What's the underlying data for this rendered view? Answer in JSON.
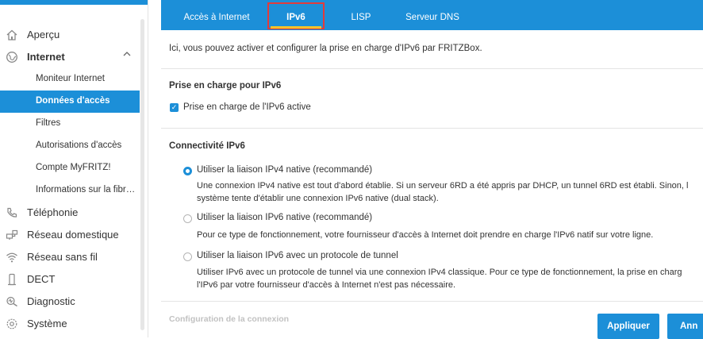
{
  "sidebar": {
    "items": [
      {
        "label": "Aperçu",
        "icon": "home-icon"
      },
      {
        "label": "Internet",
        "icon": "globe-icon",
        "expanded": true
      },
      {
        "label": "Téléphonie",
        "icon": "phone-icon"
      },
      {
        "label": "Réseau domestique",
        "icon": "network-icon"
      },
      {
        "label": "Réseau sans fil",
        "icon": "wifi-icon"
      },
      {
        "label": "DECT",
        "icon": "dect-icon"
      },
      {
        "label": "Diagnostic",
        "icon": "diagnostic-icon"
      },
      {
        "label": "Système",
        "icon": "system-icon"
      }
    ],
    "internet_sub": [
      {
        "label": "Moniteur Internet"
      },
      {
        "label": "Données d'accès",
        "active": true
      },
      {
        "label": "Filtres"
      },
      {
        "label": "Autorisations d'accès"
      },
      {
        "label": "Compte MyFRITZ!"
      },
      {
        "label": "Informations sur la fibr…"
      }
    ]
  },
  "tabs": [
    {
      "label": "Accès à Internet"
    },
    {
      "label": "IPv6",
      "active": true
    },
    {
      "label": "LISP"
    },
    {
      "label": "Serveur DNS"
    }
  ],
  "main": {
    "intro": "Ici, vous pouvez activer et configurer la prise en charge d'IPv6 par FRITZBox.",
    "support_title": "Prise en charge pour IPv6",
    "support_checkbox_label": "Prise en charge de l'IPv6 active",
    "support_checked": true,
    "connectivity_title": "Connectivité IPv6",
    "options": [
      {
        "label": "Utiliser la liaison IPv4 native (recommandé)",
        "selected": true,
        "desc_line1": "Une connexion IPv4 native est tout d'abord établie. Si un serveur 6RD a été appris par DHCP, un tunnel 6RD est établi. Sinon, l",
        "desc_line2": "système tente d'établir une connexion IPv6 native (dual stack)."
      },
      {
        "label": "Utiliser la liaison IPv6 native (recommandé)",
        "selected": false,
        "desc_line1": "Pour ce type de fonctionnement, votre fournisseur d'accès à Internet doit prendre en charge l'IPv6 natif sur votre ligne.",
        "desc_line2": ""
      },
      {
        "label": "Utiliser la liaison IPv6 avec un protocole de tunnel",
        "selected": false,
        "desc_line1": "Utiliser IPv6 avec un protocole de tunnel via une connexion IPv4 classique. Pour ce type de fonctionnement, la prise en charg",
        "desc_line2": "l'IPv6 par votre fournisseur d'accès à Internet n'est pas nécessaire."
      }
    ],
    "config_title": "Configuration de la connexion"
  },
  "footer": {
    "apply_label": "Appliquer",
    "cancel_label": "Ann"
  },
  "colors": {
    "accent": "#1c8fd8",
    "tab_highlight": "#e23b3b",
    "tab_underline": "#f3c32b"
  }
}
